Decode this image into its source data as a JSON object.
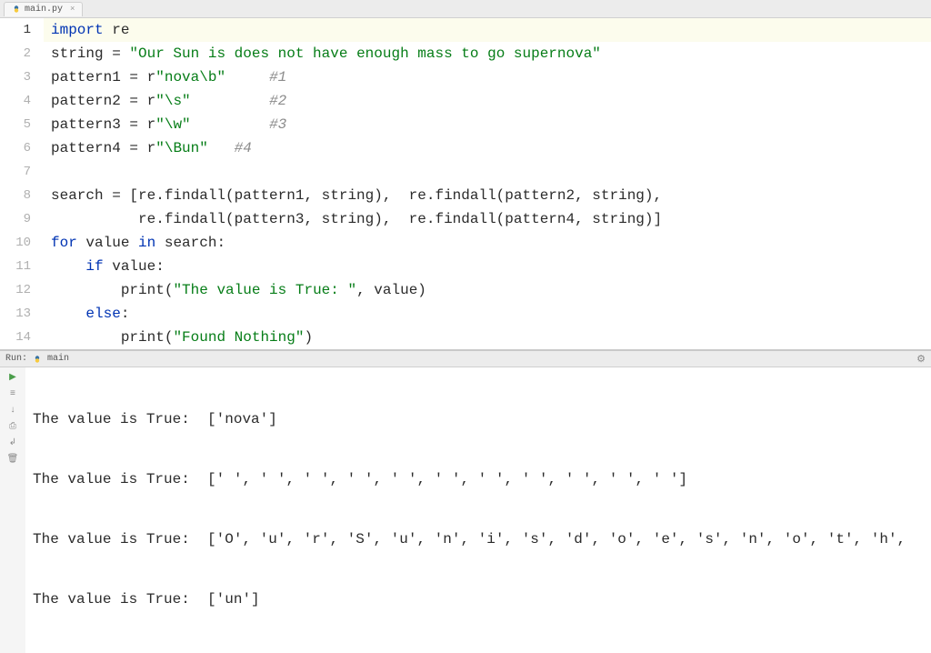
{
  "tab": {
    "filename": "main.py"
  },
  "editor": {
    "gutter": [
      "1",
      "2",
      "3",
      "4",
      "5",
      "6",
      "7",
      "8",
      "9",
      "10",
      "11",
      "12",
      "13",
      "14"
    ]
  },
  "code": {
    "l1_kw": "import",
    "l1_mod": " re",
    "l2_var": "string = ",
    "l2_str": "\"Our Sun is does not have enough mass to go supernova\"",
    "l3_var": "pattern1 = ",
    "l3_r": "r",
    "l3_str": "\"nova\\b\"",
    "l3_pad": "     ",
    "l3_cmt": "#1",
    "l4_var": "pattern2 = ",
    "l4_r": "r",
    "l4_str": "\"\\s\"",
    "l4_pad": "         ",
    "l4_cmt": "#2",
    "l5_var": "pattern3 = ",
    "l5_r": "r",
    "l5_str": "\"\\w\"",
    "l5_pad": "         ",
    "l5_cmt": "#3",
    "l6_var": "pattern4 = ",
    "l6_r": "r",
    "l6_str": "\"\\Bun\"",
    "l6_pad": "   ",
    "l6_cmt": "#4",
    "l7": "",
    "l8": "search = [re.findall(pattern1, string),  re.findall(pattern2, string),",
    "l9": "          re.findall(pattern3, string),  re.findall(pattern4, string)]",
    "l10_kw1": "for",
    "l10_mid": " value ",
    "l10_kw2": "in",
    "l10_end": " search:",
    "l11_pad": "    ",
    "l11_kw": "if",
    "l11_end": " value:",
    "l12_pad": "        ",
    "l12_fn": "print",
    "l12_p1": "(",
    "l12_str": "\"The value is True: \"",
    "l12_end": ", value)",
    "l13_pad": "    ",
    "l13_kw": "else",
    "l13_end": ":",
    "l14_pad": "        ",
    "l14_fn": "print",
    "l14_p1": "(",
    "l14_str": "\"Found Nothing\"",
    "l14_end": ")"
  },
  "run": {
    "label": "Run:",
    "config": "main"
  },
  "output": {
    "line1": "The value is True:  ['nova']",
    "line2": "The value is True:  [' ', ' ', ' ', ' ', ' ', ' ', ' ', ' ', ' ', ' ', ' ']",
    "line3": "The value is True:  ['O', 'u', 'r', 'S', 'u', 'n', 'i', 's', 'd', 'o', 'e', 's', 'n', 'o', 't', 'h',",
    "line4": "The value is True:  ['un']"
  }
}
